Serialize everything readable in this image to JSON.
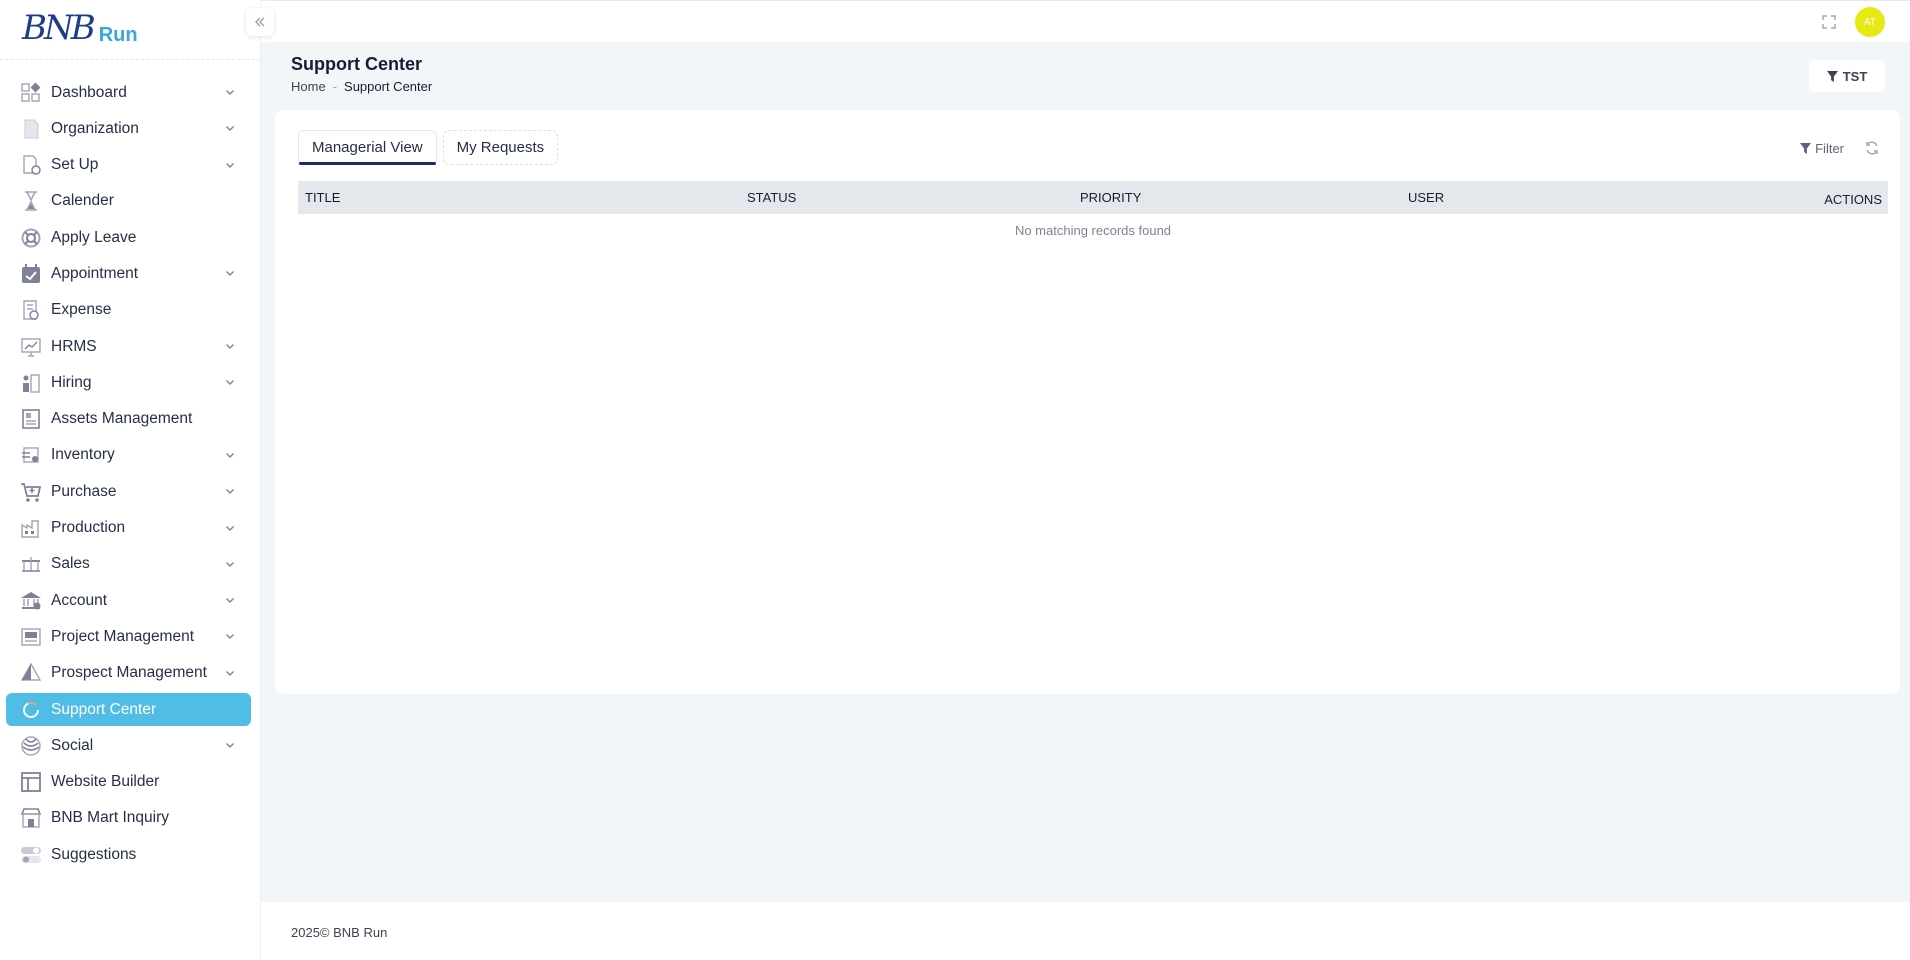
{
  "brand": {
    "logo_main": "BNB",
    "logo_sub": "Run"
  },
  "sidebar": {
    "items": [
      {
        "label": "Dashboard",
        "icon": "dashboard-icon",
        "has_arrow": true
      },
      {
        "label": "Organization",
        "icon": "document-icon",
        "has_arrow": true
      },
      {
        "label": "Set Up",
        "icon": "settings-page-icon",
        "has_arrow": true
      },
      {
        "label": "Calender",
        "icon": "hourglass-icon",
        "has_arrow": false
      },
      {
        "label": "Apply Leave",
        "icon": "lifebuoy-icon",
        "has_arrow": false
      },
      {
        "label": "Appointment",
        "icon": "calendar-check-icon",
        "has_arrow": true
      },
      {
        "label": "Expense",
        "icon": "receipt-icon",
        "has_arrow": false
      },
      {
        "label": "HRMS",
        "icon": "monitor-chart-icon",
        "has_arrow": true
      },
      {
        "label": "Hiring",
        "icon": "hiring-icon",
        "has_arrow": true
      },
      {
        "label": "Assets Management",
        "icon": "assets-icon",
        "has_arrow": false
      },
      {
        "label": "Inventory",
        "icon": "inventory-icon",
        "has_arrow": true
      },
      {
        "label": "Purchase",
        "icon": "cart-icon",
        "has_arrow": true
      },
      {
        "label": "Production",
        "icon": "factory-icon",
        "has_arrow": true
      },
      {
        "label": "Sales",
        "icon": "scale-icon",
        "has_arrow": true
      },
      {
        "label": "Account",
        "icon": "bank-icon",
        "has_arrow": true
      },
      {
        "label": "Project Management",
        "icon": "project-icon",
        "has_arrow": true
      },
      {
        "label": "Prospect Management",
        "icon": "prospect-icon",
        "has_arrow": true
      },
      {
        "label": "Support Center",
        "icon": "support-icon",
        "has_arrow": false,
        "active": true
      },
      {
        "label": "Social",
        "icon": "social-icon",
        "has_arrow": true
      },
      {
        "label": "Website Builder",
        "icon": "layout-icon",
        "has_arrow": false
      },
      {
        "label": "BNB Mart Inquiry",
        "icon": "store-icon",
        "has_arrow": false
      },
      {
        "label": "Suggestions",
        "icon": "toggle-icon",
        "has_arrow": false
      }
    ]
  },
  "topbar": {
    "avatar_initials": "AT"
  },
  "page": {
    "title": "Support Center",
    "breadcrumb": {
      "home": "Home",
      "separator": "-",
      "current": "Support Center"
    },
    "tst_label": "TST"
  },
  "tabs": [
    {
      "label": "Managerial View",
      "active": true
    },
    {
      "label": "My Requests",
      "active": false
    }
  ],
  "toolbar": {
    "filter_label": "Filter"
  },
  "table": {
    "headers": {
      "title": "TITLE",
      "status": "STATUS",
      "priority": "PRIORITY",
      "user": "USER",
      "actions": "ACTIONS"
    },
    "empty_message": "No matching records found"
  },
  "footer": {
    "text": "2025© BNB Run"
  },
  "colors": {
    "active_menu": "#50bde6",
    "avatar": "#e6ea12",
    "tab_underline": "#1e2a6b",
    "logo_blue": "#1f3c8c",
    "logo_light": "#3aa6dc"
  }
}
